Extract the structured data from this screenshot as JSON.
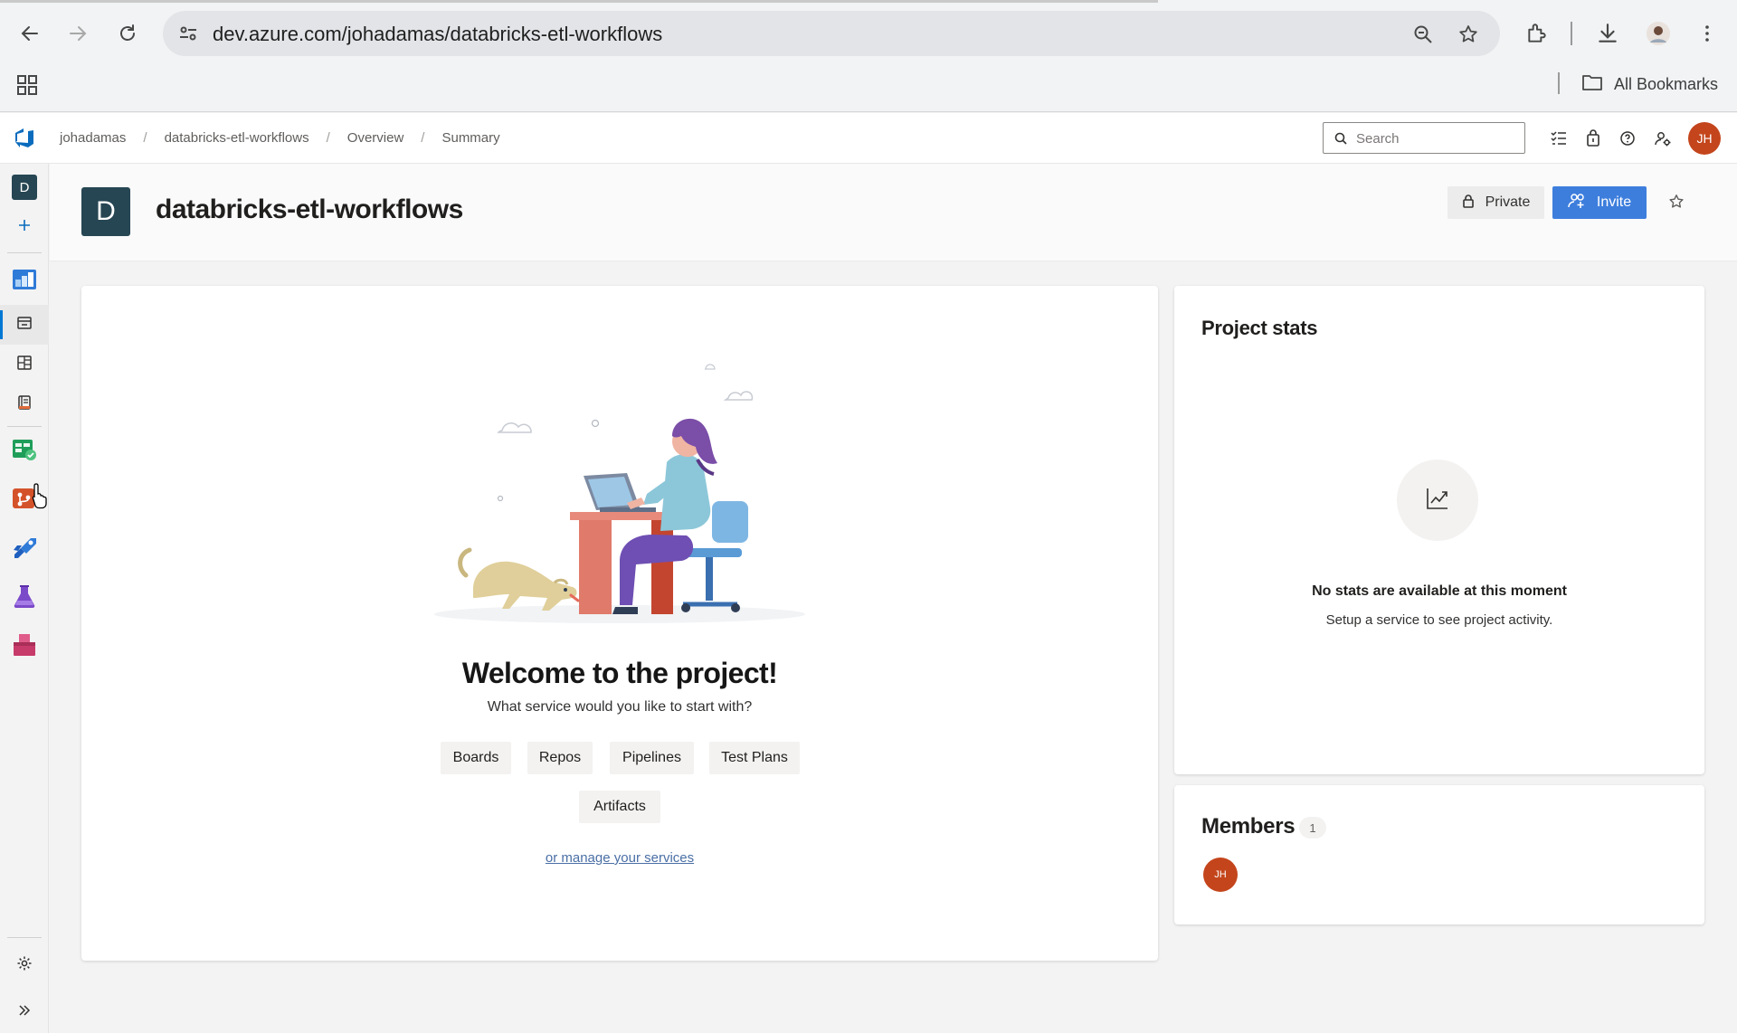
{
  "browser": {
    "url": "dev.azure.com/johadamas/databricks-etl-workflows",
    "bookmarks_label": "All Bookmarks"
  },
  "header": {
    "breadcrumbs": [
      "johadamas",
      "databricks-etl-workflows",
      "Overview",
      "Summary"
    ],
    "search_placeholder": "Search",
    "user_initials": "JH"
  },
  "rail": {
    "org_initial": "D",
    "items": [
      "overview-icon",
      "summary-icon",
      "dashboards-icon",
      "wiki-icon",
      "boards-icon",
      "repos-icon",
      "pipelines-icon",
      "test-plans-icon",
      "artifacts-icon"
    ],
    "bottom": [
      "settings-icon",
      "expand-icon"
    ]
  },
  "project": {
    "initial": "D",
    "name": "databricks-etl-workflows",
    "private_label": "Private",
    "invite_label": "Invite"
  },
  "welcome": {
    "title": "Welcome to the project!",
    "subtitle": "What service would you like to start with?",
    "services": [
      "Boards",
      "Repos",
      "Pipelines",
      "Test Plans",
      "Artifacts"
    ],
    "manage_link": "or manage your services"
  },
  "stats": {
    "title": "Project stats",
    "empty_title": "No stats are available at this moment",
    "empty_sub": "Setup a service to see project activity."
  },
  "members": {
    "title": "Members",
    "count": "1",
    "avatars": [
      "JH"
    ]
  },
  "colors": {
    "accent": "#3d7edd",
    "project_tile": "#264653",
    "avatar": "#c4451c"
  }
}
